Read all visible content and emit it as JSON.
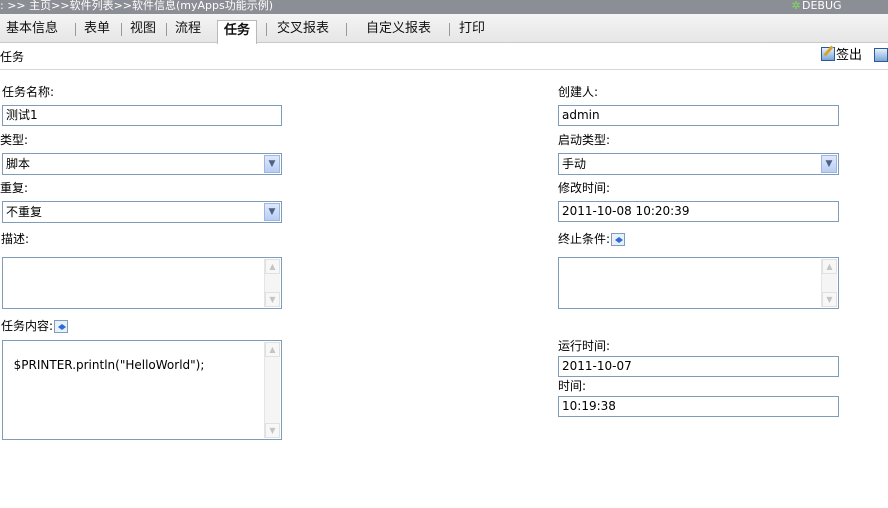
{
  "breadcrumb": ": >> 主页>>软件列表>>软件信息(myApps功能示例)",
  "debug_label": "DEBUG",
  "tabs": [
    "基本信息",
    "表单",
    "视图",
    "流程",
    "任务",
    "交叉报表",
    "自定义报表",
    "打印"
  ],
  "active_tab": "任务",
  "section_title": "任务",
  "toolbar": {
    "signout_label": "签出"
  },
  "form": {
    "task_name": {
      "label": "任务名称:",
      "value": "测试1"
    },
    "creator": {
      "label": "创建人:",
      "value": "admin"
    },
    "type": {
      "label": "类型:",
      "value": "脚本"
    },
    "start_type": {
      "label": "启动类型:",
      "value": "手动"
    },
    "repeat": {
      "label": "重复:",
      "value": "不重复"
    },
    "modified_time": {
      "label": "修改时间:",
      "value": "2011-10-08 10:20:39"
    },
    "description": {
      "label": "描述:",
      "value": ""
    },
    "stop_condition": {
      "label": "终止条件:",
      "value": ""
    },
    "task_content": {
      "label": "任务内容:",
      "value": "$PRINTER.println(\"HelloWorld\");"
    },
    "run_time": {
      "label": "运行时间:",
      "value": "2011-10-07"
    },
    "time": {
      "label": "时间:",
      "value": "10:19:38"
    }
  },
  "icons": {
    "debug": "bug-icon",
    "signout": "edit-icon",
    "save": "save-icon",
    "script_editor": "code-icon",
    "dropdown": "chevron-down-icon"
  },
  "colors": {
    "topbar": "#8b8e95",
    "tabbar": "#eaeaea",
    "field_border": "#7f9db9",
    "dropdown_button": "#c8d8f6"
  }
}
